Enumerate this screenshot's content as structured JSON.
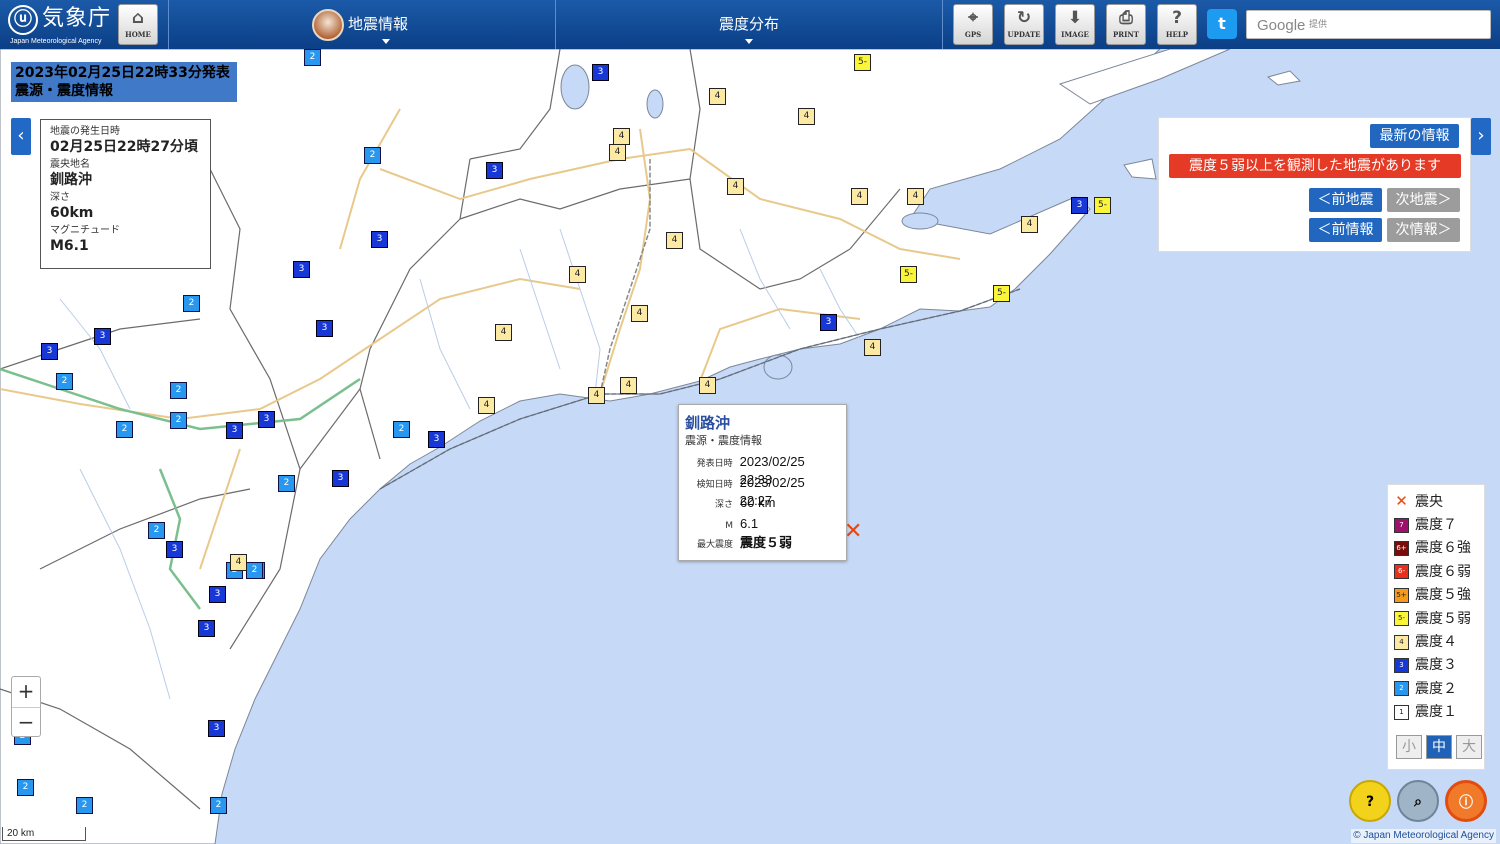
{
  "header": {
    "logo_ja": "気象庁",
    "logo_en": "Japan Meteorological Agency",
    "home_label": "HOME",
    "menu_quake": "地震情報",
    "menu_dist": "震度分布",
    "tools": [
      {
        "label": "GPS",
        "icon": "gps-icon"
      },
      {
        "label": "UPDATE",
        "icon": "update-icon"
      },
      {
        "label": "IMAGE",
        "icon": "download-icon"
      },
      {
        "label": "PRINT",
        "icon": "print-icon"
      },
      {
        "label": "HELP",
        "icon": "help-icon"
      }
    ],
    "search_brand": "Google",
    "search_note": "提供"
  },
  "issue": {
    "line1": "2023年02月25日22時33分発表",
    "line2": "震源・震度情報"
  },
  "info": {
    "time_label": "地震の発生日時",
    "time": "02月25日22時27分頃",
    "area_label": "震央地名",
    "area": "釧路沖",
    "depth_label": "深さ",
    "depth": "60km",
    "mag_label": "マグニチュード",
    "mag": "M6.1"
  },
  "panel": {
    "latest": "最新の情報",
    "alert": "震度５弱以上を観測した地震があります",
    "prev_quake": "＜前地震",
    "next_quake": "次地震＞",
    "prev_info": "＜前情報",
    "next_info": "次情報＞"
  },
  "popup": {
    "title": "釧路沖",
    "subtitle": "震源・震度情報",
    "rows": [
      {
        "k": "発表日時",
        "v": "2023/02/25 22:33"
      },
      {
        "k": "検知日時",
        "v": "2023/02/25 22:27"
      },
      {
        "k": "深さ",
        "v": "60 km"
      },
      {
        "k": "M",
        "v": "6.1"
      },
      {
        "k": "最大震度",
        "v": "震度５弱"
      }
    ]
  },
  "legend": {
    "epicenter": "震央",
    "items": [
      {
        "code": "7",
        "label": "震度７",
        "color": "#a0116c"
      },
      {
        "code": "6+",
        "label": "震度６強",
        "color": "#7a0c0c"
      },
      {
        "code": "6-",
        "label": "震度６弱",
        "color": "#e8301c"
      },
      {
        "code": "5+",
        "label": "震度５強",
        "color": "#f59a1b"
      },
      {
        "code": "5-",
        "label": "震度５弱",
        "color": "#fbf53a"
      },
      {
        "code": "4",
        "label": "震度４",
        "color": "#fbe9a4"
      },
      {
        "code": "3",
        "label": "震度３",
        "color": "#1738d6"
      },
      {
        "code": "2",
        "label": "震度２",
        "color": "#2797f0"
      },
      {
        "code": "1",
        "label": "震度１",
        "color": "#ffffff"
      }
    ],
    "sizes": [
      "小",
      "中",
      "大"
    ],
    "active_size": "中"
  },
  "map_controls": {
    "zoom_in": "+",
    "zoom_out": "−",
    "scale": "20 km",
    "copyright": "© Japan Meteorological Agency"
  },
  "markers": [
    {
      "v": "2",
      "c": "m2"
    },
    {
      "v": "3",
      "c": "m3"
    },
    {
      "v": "5-",
      "c": "m5"
    },
    {
      "v": "4",
      "c": "m4"
    },
    {
      "v": "4",
      "c": "m4"
    },
    {
      "v": "4",
      "c": "m4"
    },
    {
      "v": "4",
      "c": "m4"
    },
    {
      "v": "2",
      "c": "m2"
    },
    {
      "v": "3",
      "c": "m3"
    },
    {
      "v": "4",
      "c": "m4"
    },
    {
      "v": "4",
      "c": "m4"
    },
    {
      "v": "4",
      "c": "m4"
    },
    {
      "v": "3",
      "c": "m3"
    },
    {
      "v": "5-",
      "c": "m5"
    },
    {
      "v": "4",
      "c": "m4"
    },
    {
      "v": "4",
      "c": "m4"
    },
    {
      "v": "3",
      "c": "m3"
    },
    {
      "v": "3",
      "c": "m3"
    },
    {
      "v": "5-",
      "c": "m5"
    },
    {
      "v": "4",
      "c": "m4"
    },
    {
      "v": "5-",
      "c": "m5"
    },
    {
      "v": "2",
      "c": "m2"
    },
    {
      "v": "3",
      "c": "m3"
    },
    {
      "v": "3",
      "c": "m3"
    },
    {
      "v": "4",
      "c": "m4"
    },
    {
      "v": "4",
      "c": "m4"
    },
    {
      "v": "3",
      "c": "m3"
    },
    {
      "v": "3",
      "c": "m3"
    },
    {
      "v": "2",
      "c": "m2"
    },
    {
      "v": "4",
      "c": "m4"
    },
    {
      "v": "4",
      "c": "m4"
    },
    {
      "v": "4",
      "c": "m4"
    },
    {
      "v": "4",
      "c": "m4"
    },
    {
      "v": "4",
      "c": "m4"
    },
    {
      "v": "2",
      "c": "m2"
    },
    {
      "v": "2",
      "c": "m2"
    },
    {
      "v": "3",
      "c": "m3"
    },
    {
      "v": "3",
      "c": "m3"
    },
    {
      "v": "2",
      "c": "m2"
    },
    {
      "v": "3",
      "c": "m3"
    },
    {
      "v": "2",
      "c": "m2"
    },
    {
      "v": "3",
      "c": "m3"
    },
    {
      "v": "3",
      "c": "m3"
    },
    {
      "v": "2",
      "c": "m2"
    },
    {
      "v": "2",
      "c": "m2"
    },
    {
      "v": "3",
      "c": "m3"
    },
    {
      "v": "2",
      "c": "m2"
    },
    {
      "v": "3",
      "c": "m3"
    },
    {
      "v": "2",
      "c": "m2"
    },
    {
      "v": "2",
      "c": "m2"
    },
    {
      "v": "4",
      "c": "m4"
    },
    {
      "v": "3",
      "c": "m3"
    },
    {
      "v": "3",
      "c": "m3"
    },
    {
      "v": "3",
      "c": "m3"
    },
    {
      "v": "2",
      "c": "m2"
    },
    {
      "v": "2",
      "c": "m2"
    },
    {
      "v": "2",
      "c": "m2"
    },
    {
      "v": "2",
      "c": "m2"
    },
    {
      "v": "3",
      "c": "m3"
    }
  ]
}
